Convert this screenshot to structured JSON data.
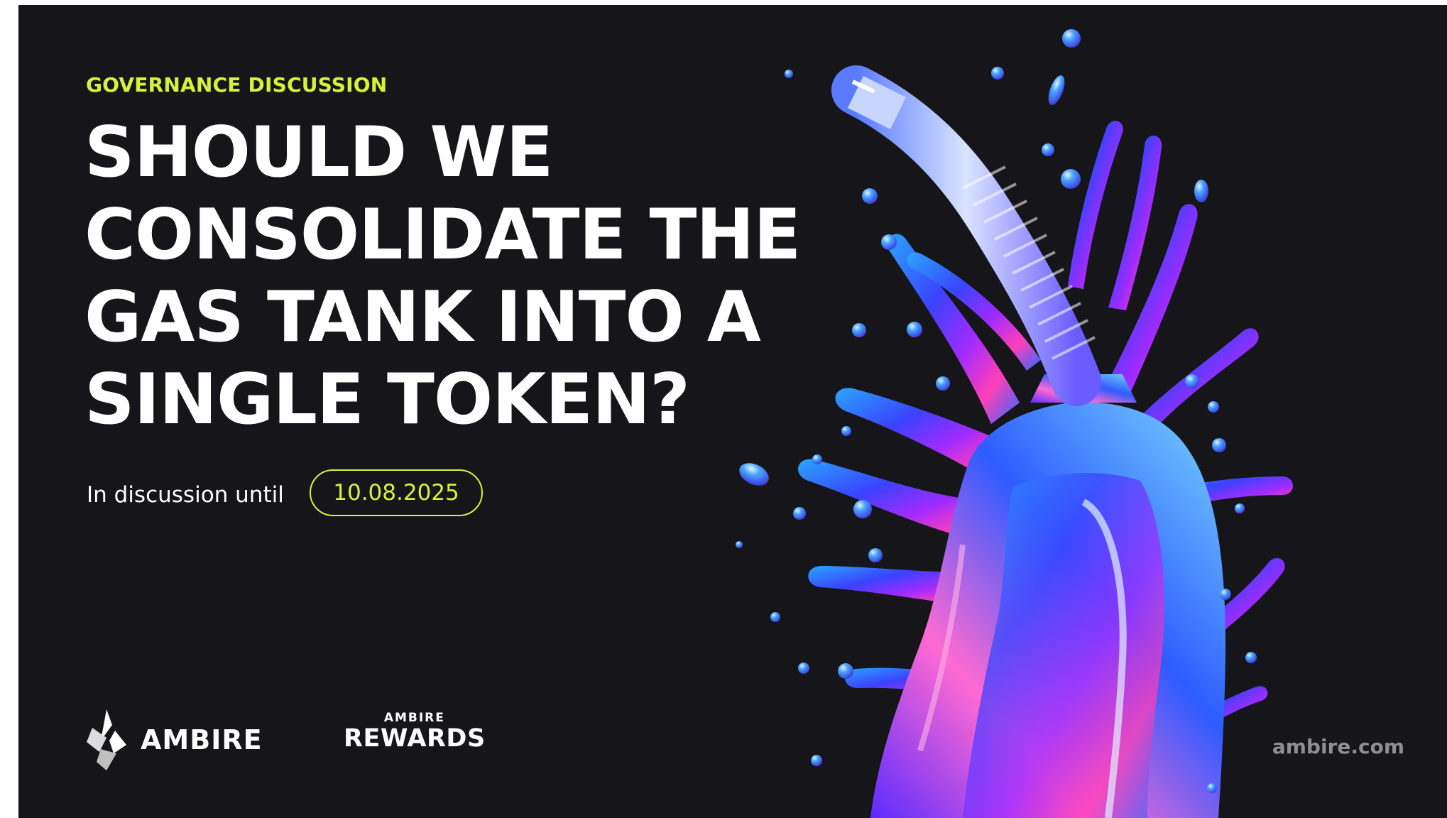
{
  "eyebrow": "GOVERNANCE DISCUSSION",
  "headline": {
    "lines": [
      "SHOULD WE",
      "CONSOLIDATE THE",
      "GAS TANK INTO A",
      "SINGLE TOKEN?"
    ]
  },
  "deadline": {
    "label": "In discussion until",
    "date": "10.08.2025"
  },
  "brand": {
    "name": "AMBIRE",
    "rewards_small": "AMBIRE",
    "rewards_big": "REWARDS",
    "domain": "ambire.com"
  },
  "colors": {
    "background": "#16161a",
    "accent": "#d6f23b",
    "text": "#ffffff",
    "muted": "#8e8e93"
  },
  "icons": {
    "logo": "ambire-logo-icon",
    "art": "iridescent-gas-canister-splash"
  }
}
